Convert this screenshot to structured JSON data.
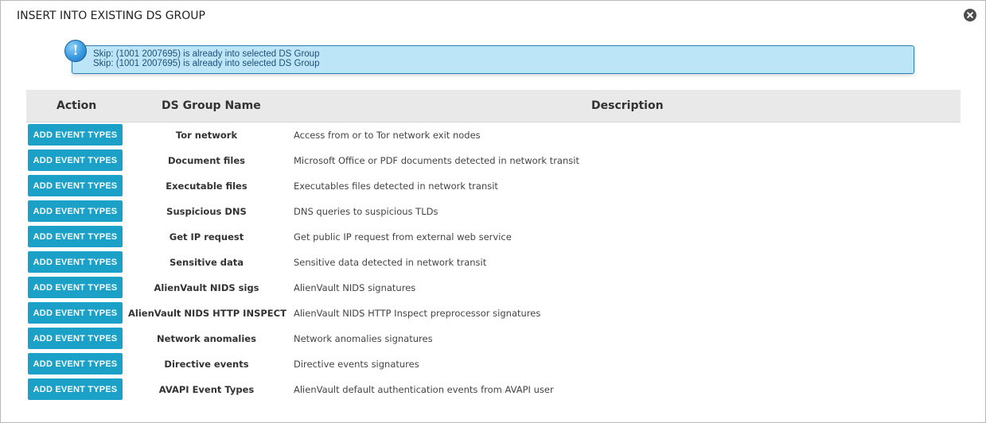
{
  "dialog": {
    "title": "INSERT INTO EXISTING DS GROUP",
    "close_icon": "close-circle-icon"
  },
  "notice": {
    "icon": "info-icon",
    "icon_glyph": "!",
    "lines": [
      "Skip: (1001 2007695) is already into selected DS Group",
      "Skip: (1001 2007695) is already into selected DS Group"
    ]
  },
  "table": {
    "headers": {
      "action": "Action",
      "name": "DS Group Name",
      "description": "Description"
    },
    "button_label": "ADD EVENT TYPES",
    "rows": [
      {
        "name": "Tor network",
        "description": "Access from or to Tor network exit nodes"
      },
      {
        "name": "Document files",
        "description": "Microsoft Office or PDF documents detected in network transit"
      },
      {
        "name": "Executable files",
        "description": "Executables files detected in network transit"
      },
      {
        "name": "Suspicious DNS",
        "description": "DNS queries to suspicious TLDs"
      },
      {
        "name": "Get IP request",
        "description": "Get public IP request from external web service"
      },
      {
        "name": "Sensitive data",
        "description": "Sensitive data detected in network transit"
      },
      {
        "name": "AlienVault NIDS sigs",
        "description": "AlienVault NIDS signatures"
      },
      {
        "name": "AlienVault NIDS HTTP INSPECT",
        "description": "AlienVault NIDS HTTP Inspect preprocessor signatures"
      },
      {
        "name": "Network anomalies",
        "description": "Network anomalies signatures"
      },
      {
        "name": "Directive events",
        "description": "Directive events signatures"
      },
      {
        "name": "AVAPI Event Types",
        "description": "AlienVault default authentication events from AVAPI user"
      }
    ]
  },
  "colors": {
    "button_bg": "#1ba0c7",
    "notice_bg": "#bde5f8",
    "header_bg": "#e9e9e9"
  }
}
